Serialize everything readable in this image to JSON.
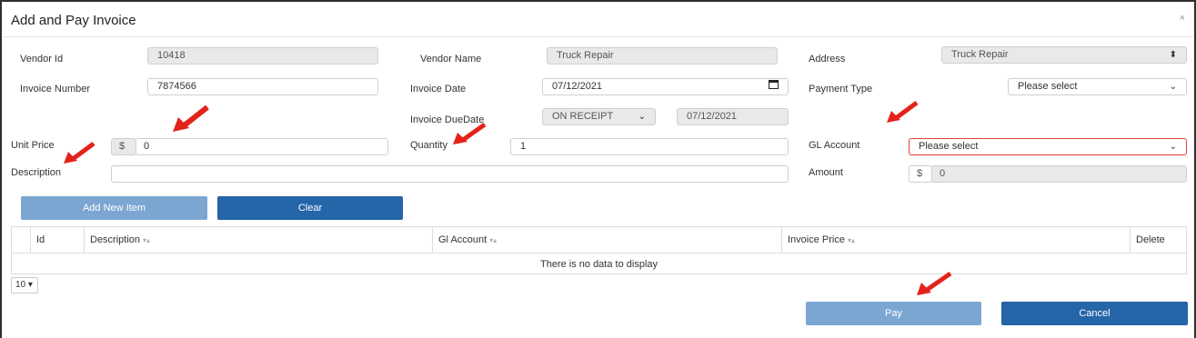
{
  "dialog": {
    "title": "Add and Pay Invoice",
    "close": "×"
  },
  "vendor": {
    "id_label": "Vendor Id",
    "id_value": "10418",
    "name_label": "Vendor Name",
    "name_value": "Truck Repair",
    "address_label": "Address",
    "address_value": "Truck Repair"
  },
  "invoice": {
    "number_label": "Invoice Number",
    "number_value": "7874566",
    "date_label": "Invoice Date",
    "date_value": "07/12/2021",
    "payment_type_label": "Payment Type",
    "payment_type_value": "Please select",
    "due_label": "Invoice DueDate",
    "due_term": "ON RECEIPT",
    "due_value": "07/12/2021"
  },
  "item": {
    "unit_price_label": "Unit Price",
    "currency": "$",
    "unit_price_value": "0",
    "quantity_label": "Quantity",
    "quantity_value": "1",
    "gl_label": "GL Account",
    "gl_value": "Please select",
    "description_label": "Description",
    "description_value": "",
    "amount_label": "Amount",
    "amount_value": "0"
  },
  "buttons": {
    "add": "Add New Item",
    "clear": "Clear",
    "pay": "Pay",
    "cancel": "Cancel"
  },
  "grid": {
    "columns": [
      "Id",
      "Description",
      "Gl Account",
      "Invoice Price",
      "Delete"
    ],
    "empty": "There is no data to display",
    "page_size": "10"
  },
  "colors": {
    "accent": "#2566a8",
    "accent_light": "#7ba6d1",
    "error": "#e2413a",
    "annotation": "#e3231b"
  }
}
